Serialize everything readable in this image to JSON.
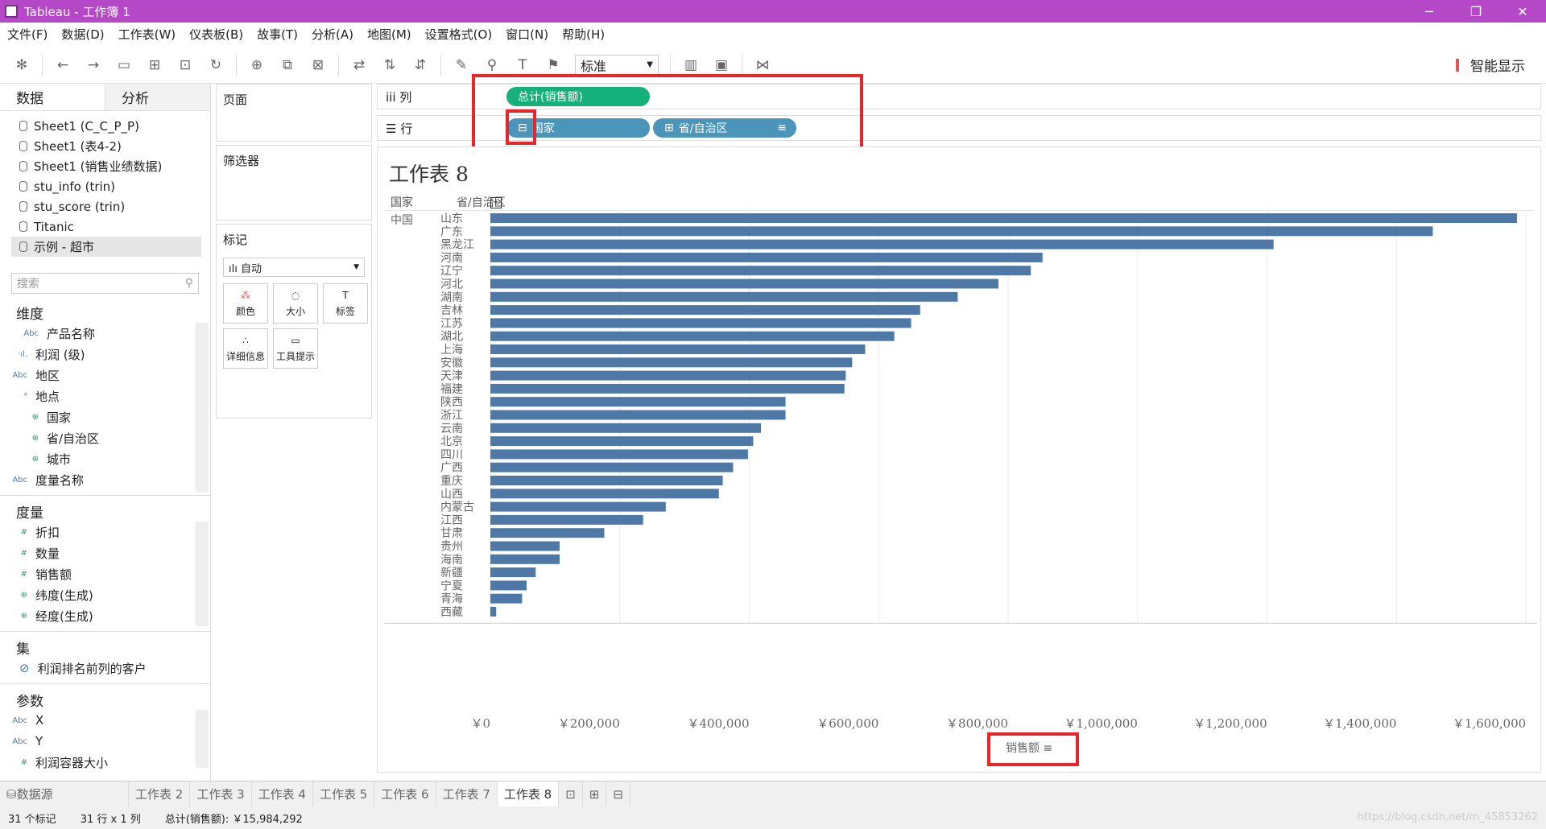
{
  "window": {
    "title": "Tableau - 工作簿 1",
    "app_icon": "tableau-icon"
  },
  "menu": [
    "文件(F)",
    "数据(D)",
    "工作表(W)",
    "仪表板(B)",
    "故事(T)",
    "分析(A)",
    "地图(M)",
    "设置格式(O)",
    "窗口(N)",
    "帮助(H)"
  ],
  "toolbar": {
    "fit_select": "标准",
    "smart": "智能显示"
  },
  "left": {
    "tab_data": "数据",
    "tab_analysis": "分析",
    "datasources": [
      "Sheet1 (C_C_P_P)",
      "Sheet1 (表4-2)",
      "Sheet1 (销售业绩数据)",
      "stu_info (trin)",
      "stu_score (trin)",
      "Titanic",
      "示例 - 超市"
    ],
    "search_placeholder": "搜索",
    "dimensions_title": "维度",
    "dimensions": [
      {
        "type": "Abc",
        "name": "产品名称",
        "indent": 2
      },
      {
        "type": "·ıl.",
        "name": "利润 (级)",
        "indent": 1
      },
      {
        "type": "Abc",
        "name": "地区",
        "indent": 1
      },
      {
        "type": "ᴬ",
        "name": "地点",
        "indent": 1
      },
      {
        "type": "⊕",
        "name": "国家",
        "indent": 2
      },
      {
        "type": "⊕",
        "name": "省/自治区",
        "indent": 2
      },
      {
        "type": "⊕",
        "name": "城市",
        "indent": 2
      },
      {
        "type": "Abc",
        "name": "度量名称",
        "indent": 1
      }
    ],
    "measures_title": "度量",
    "measures": [
      {
        "type": "#",
        "name": "折扣"
      },
      {
        "type": "#",
        "name": "数量"
      },
      {
        "type": "#",
        "name": "销售额"
      },
      {
        "type": "⊕",
        "name": "纬度(生成)"
      },
      {
        "type": "⊕",
        "name": "经度(生成)"
      }
    ],
    "sets_title": "集",
    "sets": [
      "利润排名前列的客户"
    ],
    "params_title": "参数",
    "params": [
      {
        "type": "Abc",
        "name": "X"
      },
      {
        "type": "Abc",
        "name": "Y"
      },
      {
        "type": "#",
        "name": "利润容器大小"
      }
    ]
  },
  "cards": {
    "pages": "页面",
    "filters": "筛选器",
    "marks": "标记",
    "marks_type": "自动",
    "mark_buttons": [
      {
        "icon": "color-icon",
        "label": "颜色"
      },
      {
        "icon": "size-icon",
        "label": "大小"
      },
      {
        "icon": "label-icon",
        "label": "标签"
      },
      {
        "icon": "detail-icon",
        "label": "详细信息"
      },
      {
        "icon": "tooltip-icon",
        "label": "工具提示"
      }
    ]
  },
  "shelves": {
    "columns_label": "列",
    "rows_label": "行",
    "columns_pill": "总计(销售额)",
    "rows_pills": [
      "国家",
      "省/自治区"
    ]
  },
  "view": {
    "title": "工作表 8",
    "header_country": "国家",
    "header_province": "省/自治区",
    "country": "中国",
    "axis_title": "销售额"
  },
  "chart_data": {
    "type": "bar",
    "orientation": "horizontal",
    "categories": [
      "山东",
      "广东",
      "黑龙江",
      "河南",
      "辽宁",
      "河北",
      "湖南",
      "吉林",
      "江苏",
      "湖北",
      "上海",
      "安徽",
      "天津",
      "福建",
      "陕西",
      "浙江",
      "云南",
      "北京",
      "四川",
      "广西",
      "重庆",
      "山西",
      "内蒙古",
      "江西",
      "甘肃",
      "贵州",
      "海南",
      "新疆",
      "宁夏",
      "青海",
      "西藏"
    ],
    "values": [
      1586000,
      1456000,
      1210000,
      853000,
      835000,
      785000,
      722000,
      664000,
      650000,
      624000,
      579000,
      559000,
      549000,
      547000,
      456000,
      456000,
      418000,
      406000,
      398000,
      375000,
      359000,
      353000,
      271000,
      236000,
      176000,
      107000,
      107000,
      70000,
      56000,
      49000,
      9000
    ],
    "xlabel": "销售额",
    "xlim": [
      0,
      1600000
    ],
    "ticks": [
      "￥0",
      "￥200,000",
      "￥400,000",
      "￥600,000",
      "￥800,000",
      "￥1,000,000",
      "￥1,200,000",
      "￥1,400,000",
      "￥1,600,000"
    ],
    "color": "#4e79a7"
  },
  "bottom_tabs": [
    "数据源",
    "工作表 2",
    "工作表 3",
    "工作表 4",
    "工作表 5",
    "工作表 6",
    "工作表 7",
    "工作表 8"
  ],
  "status": {
    "marks": "31 个标记",
    "rows": "31 行 x 1 列",
    "sum": "总计(销售额): ￥15,984,292",
    "watermark": "https://blog.csdn.net/m_45853262"
  }
}
